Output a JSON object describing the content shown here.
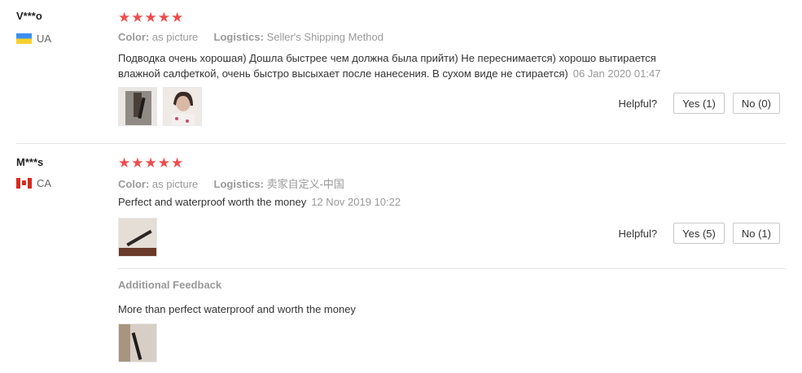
{
  "reviews": [
    {
      "user": "V***o",
      "country": "UA",
      "stars": "★★★★★",
      "color_label": "Color:",
      "color_value": "as picture",
      "logistics_label": "Logistics:",
      "logistics_value": "Seller's Shipping Method",
      "text_line1": "Подводка очень хорошая) Дошла быстрее чем должна была прийти) Не переснимается) хорошо вытирается",
      "text_line2": "влажной салфеткой, очень быстро высыхает после нанесения. В сухом виде не стирается)",
      "date": "06 Jan 2020 01:47",
      "helpful_label": "Helpful?",
      "yes_label": "Yes (1)",
      "no_label": "No (0)"
    },
    {
      "user": "M***s",
      "country": "CA",
      "stars": "★★★★★",
      "color_label": "Color:",
      "color_value": "as picture",
      "logistics_label": "Logistics:",
      "logistics_value": "卖家自定义-中国",
      "text": "Perfect and waterproof worth the money",
      "date": "12 Nov 2019 10:22",
      "helpful_label": "Helpful?",
      "yes_label": "Yes (5)",
      "no_label": "No (1)",
      "additional_title": "Additional Feedback",
      "additional_text": "More than perfect waterproof and worth the money"
    }
  ]
}
